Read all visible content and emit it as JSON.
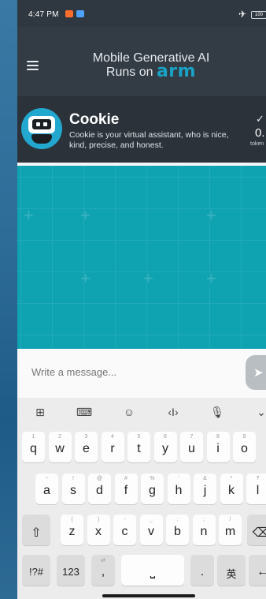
{
  "status_bar": {
    "time": "4:47 PM",
    "battery": "100"
  },
  "app_bar": {
    "title_line1": "Mobile Generative AI",
    "title_line2_prefix": "Runs on",
    "brand": "arm"
  },
  "assistant": {
    "name": "Cookie",
    "description": "Cookie is your virtual assistant, who is nice, kind, precise, and honest.",
    "token_value": "0.",
    "token_label": "token"
  },
  "message_input": {
    "placeholder": "Write a message..."
  },
  "keyboard": {
    "row1": [
      {
        "key": "q",
        "hint": "1"
      },
      {
        "key": "w",
        "hint": "2"
      },
      {
        "key": "e",
        "hint": "3"
      },
      {
        "key": "r",
        "hint": "4"
      },
      {
        "key": "t",
        "hint": "5"
      },
      {
        "key": "y",
        "hint": "6"
      },
      {
        "key": "u",
        "hint": "7"
      },
      {
        "key": "i",
        "hint": "8"
      },
      {
        "key": "o",
        "hint": "9"
      }
    ],
    "row2": [
      {
        "key": "a",
        "hint": "~"
      },
      {
        "key": "s",
        "hint": "!"
      },
      {
        "key": "d",
        "hint": "@"
      },
      {
        "key": "f",
        "hint": "#"
      },
      {
        "key": "g",
        "hint": "%"
      },
      {
        "key": "h",
        "hint": "'"
      },
      {
        "key": "j",
        "hint": "&"
      },
      {
        "key": "k",
        "hint": "*"
      },
      {
        "key": "l",
        "hint": "?"
      }
    ],
    "row3": [
      {
        "key": "z",
        "hint": "("
      },
      {
        "key": "x",
        "hint": ")"
      },
      {
        "key": "c",
        "hint": "-"
      },
      {
        "key": "v",
        "hint": "_"
      },
      {
        "key": "b",
        "hint": ":"
      },
      {
        "key": "n",
        "hint": ";"
      },
      {
        "key": "m",
        "hint": "/"
      }
    ],
    "symbols_label": "!?#",
    "numbers_label": "123",
    "comma_label": ",",
    "period_label": ".",
    "language_label": "英"
  }
}
